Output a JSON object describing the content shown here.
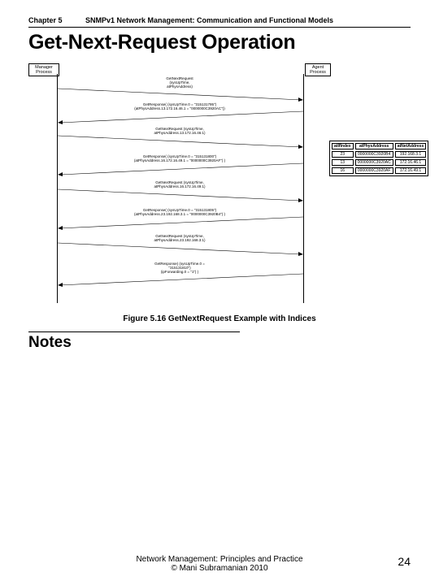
{
  "header": {
    "chapter": "Chapter 5",
    "subtitle": "SNMPv1 Network Management: Communication and Functional Models"
  },
  "title": "Get-Next-Request Operation",
  "processes": {
    "manager": "Manager\nProcess",
    "agent": "Agent\nProcess"
  },
  "messages": [
    "GetNextRequest\n(sysUpTime,\natPhysAddress)",
    "GetResponse( (sysUpTime.0 = \"315131795\")\n(atPhysAddress.13.172.16.46.1 = \"0000000C3920AC\"))",
    "GetNextRequest (sysUpTime,\natPhysAddress.13.172.16.46.1)",
    "GetResponse( (sysUpTime.0 = \"315131800\")\n(atPhysAddress.16.172.16.49.1 = \"0000000C3920AF\") )",
    "GetNextRequest (sysUpTime,\natPhysAddress.16.172.16.49.1)",
    "GetResponse( (sysUpTime.0 = \"315131805\")\n(atPhysAddress.23.192.168.3.1 = \"0000000C3920B4\") )",
    "GetNextRequest (sysUpTime,\natPhysAddress.23.192.168.3.1)",
    "GetResponse( (sysUpTime.0 =\n\"315131810\")\n(ipForwarding.0 = \"1\") )"
  ],
  "table": {
    "headers": [
      "atIfIndex",
      "atPhysAddress",
      "atNetAddress"
    ],
    "rows": [
      [
        "23",
        "0000000C3920B4",
        "192.168.3.1"
      ],
      [
        "13",
        "0000000C3920AC",
        "172.16.46.1"
      ],
      [
        "16",
        "0000000C3920AF",
        "172.16.49.1"
      ]
    ]
  },
  "caption": "Figure 5.16 GetNextRequest Example with Indices",
  "notes_label": "Notes",
  "footer": {
    "line1": "Network Management: Principles and Practice",
    "line2": "© Mani Subramanian 2010",
    "page": "24"
  }
}
